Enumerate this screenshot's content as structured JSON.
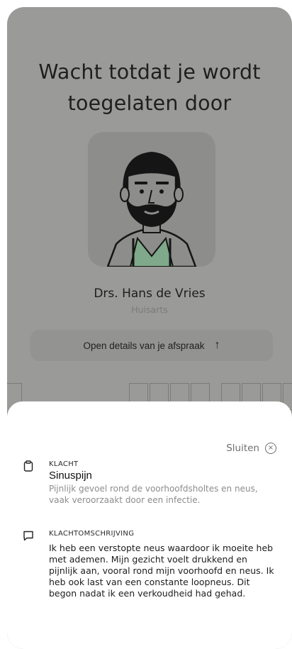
{
  "background": {
    "title_line1": "Wacht totdat je wordt",
    "title_line2": "toegelaten door",
    "doctor_name": "Drs. Hans de Vries",
    "doctor_role": "Huisarts",
    "open_details_label": "Open details van je afspraak",
    "open_details_icon": "arrow-up-icon"
  },
  "sheet": {
    "close_label": "Sluiten",
    "close_icon": "close-circle-icon",
    "complaint": {
      "icon": "clipboard-icon",
      "label": "KLACHT",
      "title": "Sinuspijn",
      "description": "Pijnlijk gevoel rond de voorhoofdsholtes en neus, vaak veroorzaakt door een infectie."
    },
    "complaint_description": {
      "icon": "chat-bubble-icon",
      "label": "KLACHTOMSCHRIJVING",
      "text": "Ik heb een verstopte neus waardoor ik moeite heb met ademen. Mijn gezicht voelt drukkend en pijnlijk aan, vooral rond mijn voorhoofd en neus. Ik heb ook last van een constante loopneus. Dit begon nadat ik een verkoudheid had gehad."
    }
  }
}
